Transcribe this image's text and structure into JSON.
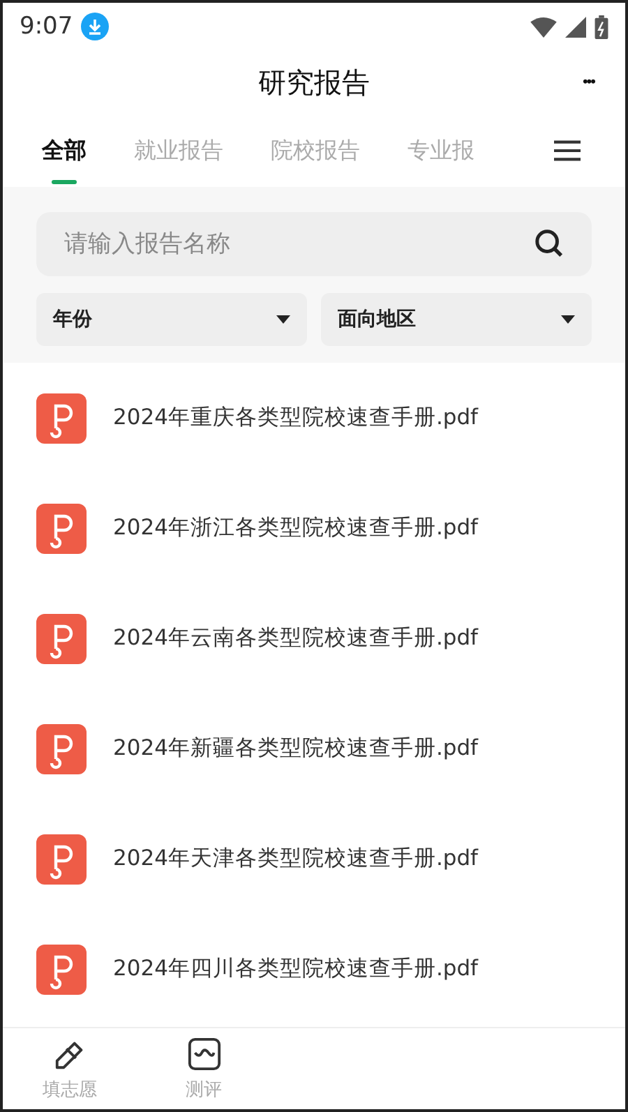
{
  "status_bar": {
    "time": "9:07"
  },
  "header": {
    "title": "研究报告",
    "more": "•••"
  },
  "tabs": [
    {
      "label": "全部",
      "selected": true
    },
    {
      "label": "就业报告",
      "selected": false
    },
    {
      "label": "院校报告",
      "selected": false
    },
    {
      "label": "专业报",
      "selected": false
    }
  ],
  "search": {
    "placeholder": "请输入报告名称"
  },
  "filters": [
    {
      "label": "年份"
    },
    {
      "label": "面向地区"
    }
  ],
  "files": [
    {
      "name": "2024年重庆各类型院校速查手册.pdf"
    },
    {
      "name": "2024年浙江各类型院校速查手册.pdf"
    },
    {
      "name": "2024年云南各类型院校速查手册.pdf"
    },
    {
      "name": "2024年新疆各类型院校速查手册.pdf"
    },
    {
      "name": "2024年天津各类型院校速查手册.pdf"
    },
    {
      "name": "2024年四川各类型院校速查手册.pdf"
    }
  ],
  "bottom_nav": [
    {
      "label": "填志愿",
      "kind": "pencil"
    },
    {
      "label": "测评",
      "kind": "chart"
    }
  ]
}
